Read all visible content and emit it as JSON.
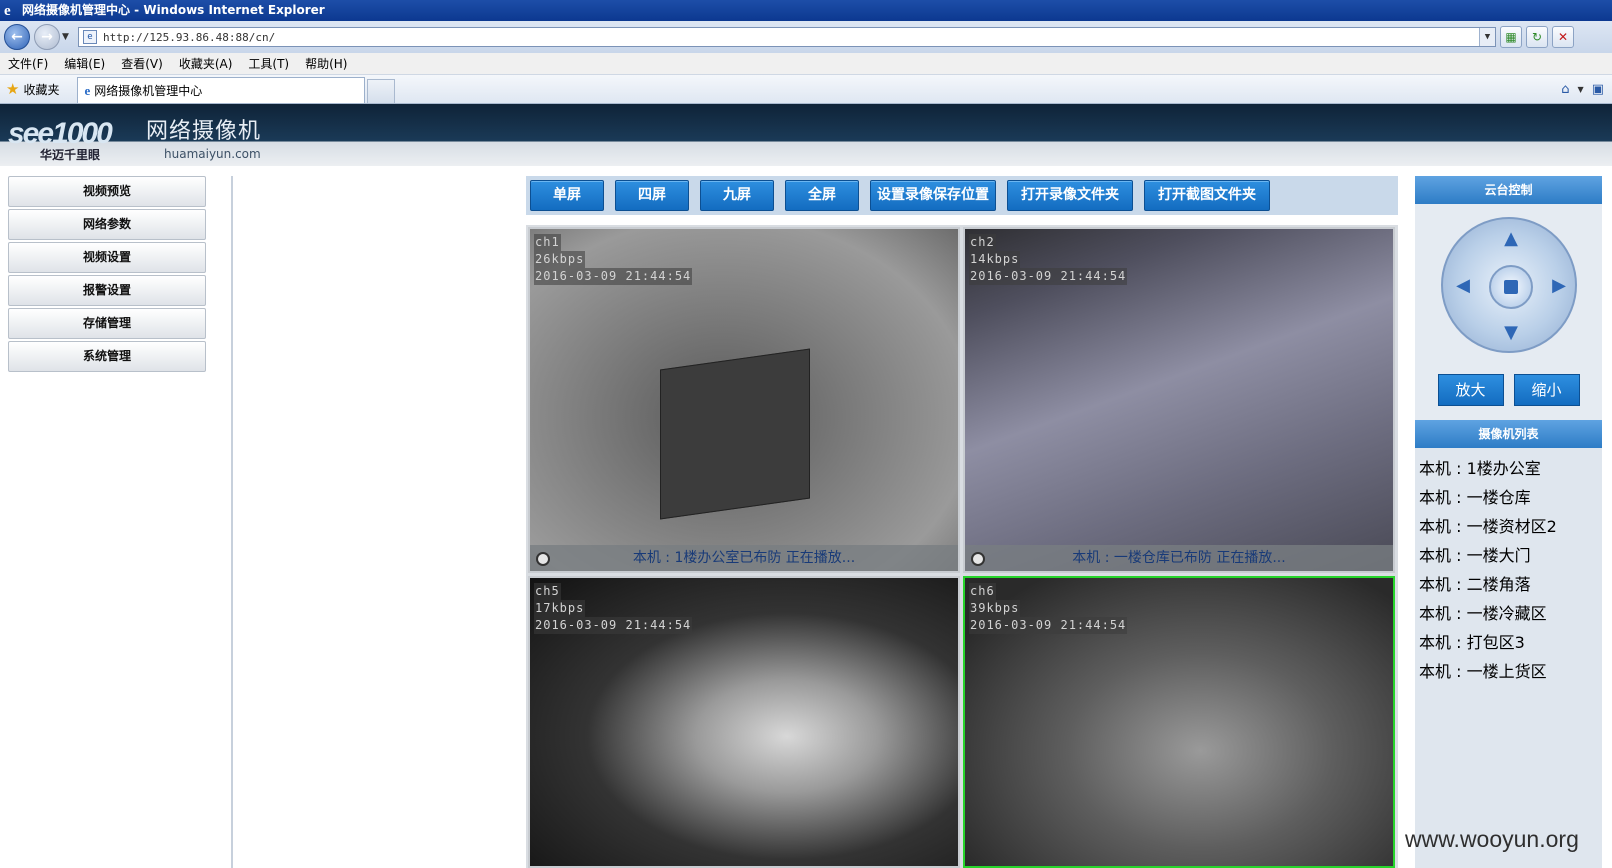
{
  "window": {
    "title": "网络摄像机管理中心 - Windows Internet Explorer"
  },
  "browser": {
    "url": "http://125.93.86.48:88/cn/",
    "menu": [
      "文件(F)",
      "编辑(E)",
      "查看(V)",
      "收藏夹(A)",
      "工具(T)",
      "帮助(H)"
    ],
    "favorites_label": "收藏夹",
    "tab_title": "网络摄像机管理中心"
  },
  "header": {
    "logo_mark_a": "see",
    "logo_mark_b": "1000",
    "logo_sub": "华迈千里眼",
    "title": "网络摄像机",
    "domain": "huamaiyun.com"
  },
  "sidebar": {
    "items": [
      "视频预览",
      "网络参数",
      "视频设置",
      "报警设置",
      "存储管理",
      "系统管理"
    ]
  },
  "toolbar": {
    "buttons": [
      "单屏",
      "四屏",
      "九屏",
      "全屏",
      "设置录像保存位置",
      "打开录像文件夹",
      "打开截图文件夹"
    ]
  },
  "cameras": [
    {
      "channel": "ch1",
      "bitrate": "26kbps",
      "timestamp": "2016-03-09 21:44:54",
      "status": "本机 : 1楼办公室已布防 正在播放..."
    },
    {
      "channel": "ch2",
      "bitrate": "14kbps",
      "timestamp": "2016-03-09 21:44:54",
      "status": "本机 : 一楼仓库已布防 正在播放..."
    },
    {
      "channel": "ch5",
      "bitrate": "17kbps",
      "timestamp": "2016-03-09 21:44:54",
      "status": ""
    },
    {
      "channel": "ch6",
      "bitrate": "39kbps",
      "timestamp": "2016-03-09 21:44:54",
      "status": ""
    }
  ],
  "ptz": {
    "title": "云台控制",
    "zoom_in": "放大",
    "zoom_out": "缩小"
  },
  "camera_list": {
    "title": "摄像机列表",
    "items": [
      "本机 : 1楼办公室",
      "本机 : 一楼仓库",
      "本机 : 一楼资材区2",
      "本机 : 一楼大门",
      "本机 : 二楼角落",
      "本机 : 一楼冷藏区",
      "本机 : 打包区3",
      "本机 : 一楼上货区"
    ]
  },
  "watermark": "www.wooyun.org",
  "colors": {
    "accent": "#1a7bd0",
    "active_border": "#27d52b",
    "header_dark": "#0f2338"
  }
}
